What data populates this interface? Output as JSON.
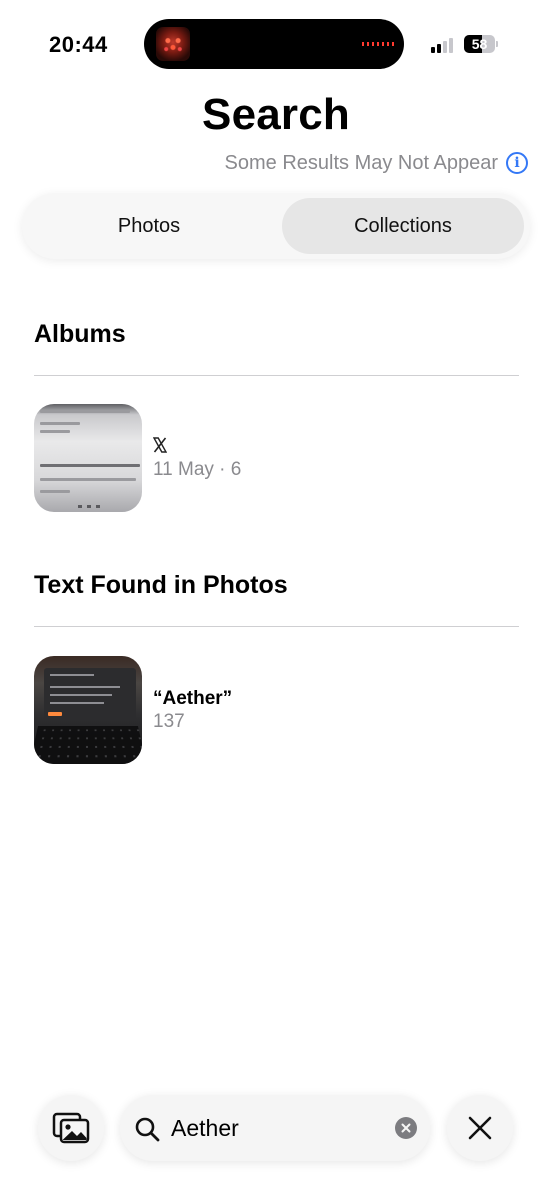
{
  "status_bar": {
    "time": "20:44",
    "battery_percent": "58",
    "battery_level": 0.58,
    "signal_bars_active": 2,
    "signal_bars_total": 4
  },
  "header": {
    "title": "Search",
    "notice": "Some Results May Not Appear"
  },
  "tabs": [
    {
      "label": "Photos",
      "selected": false
    },
    {
      "label": "Collections",
      "selected": true
    }
  ],
  "albums": {
    "heading": "Albums",
    "items": [
      {
        "icon": "x-logo-icon",
        "meta": "11 May · 6"
      }
    ]
  },
  "text_found": {
    "heading": "Text Found in Photos",
    "items": [
      {
        "title": "“Aether”",
        "count": "137"
      }
    ]
  },
  "search": {
    "value": "Aether"
  },
  "colors": {
    "accent": "#3478f6",
    "secondary_text": "#8a8a8e",
    "selected_segment": "#e6e6e6"
  }
}
